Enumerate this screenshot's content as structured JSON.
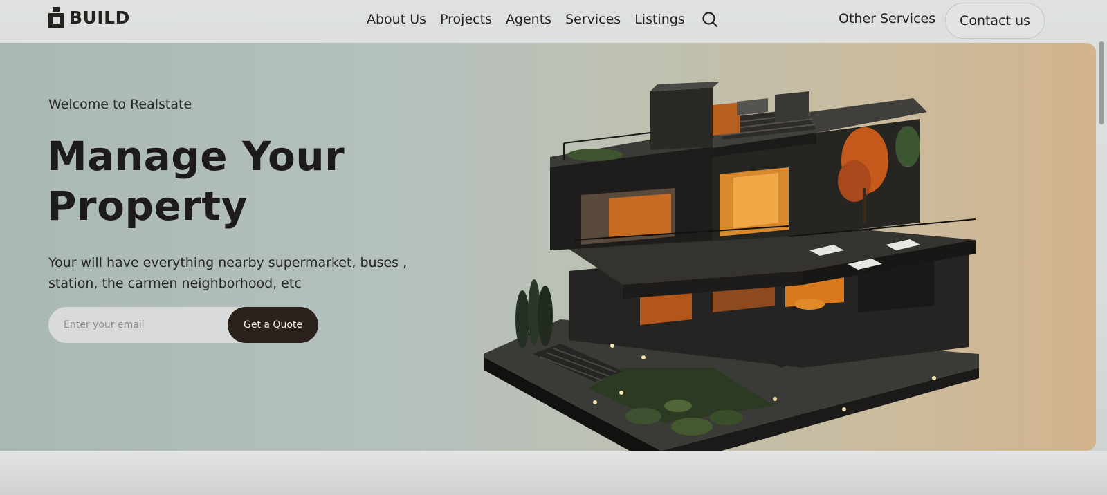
{
  "brand": {
    "name": "BUILD",
    "icon": "building-icon"
  },
  "nav": {
    "links": [
      "About Us",
      "Projects",
      "Agents",
      "Services",
      "Listings"
    ],
    "search_icon": "search-icon",
    "other_services": "Other Services",
    "contact": "Contact us"
  },
  "hero": {
    "welcome": "Welcome to Realstate",
    "headline_line1": "Manage Your",
    "headline_line2": "Property",
    "subtext_line1": "Your will have everything nearby supermarket, buses ,",
    "subtext_line2": "station, the carmen neighborhood, etc",
    "email_placeholder": "Enter your email",
    "cta": "Get a Quote",
    "image": "modern-house-illustration"
  },
  "colors": {
    "dark": "#2a201c",
    "hero_left": "#aab8b5",
    "hero_right": "#d2b48d"
  }
}
